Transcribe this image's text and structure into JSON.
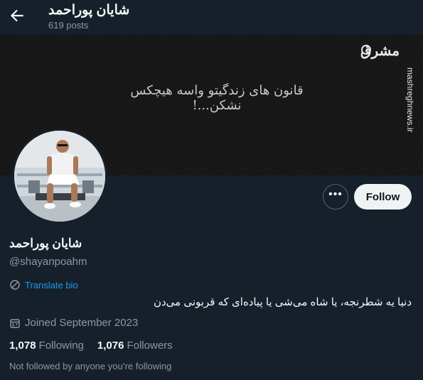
{
  "header": {
    "name": "شایان پوراحمد",
    "posts": "619 posts"
  },
  "banner": {
    "quote": "قانون های زندگیتو واسه هیچکس نشکن...!",
    "watermark_logo": "مشرق",
    "watermark_site": "mashreghnews.ir"
  },
  "actions": {
    "more": "•••",
    "follow": "Follow"
  },
  "profile": {
    "display_name": "شایان پوراحمد",
    "handle": "@shayanpoahm",
    "translate": "Translate bio",
    "bio": "دنیا یه شطرنجه، یا شاه می‌شی یا پیاده‌ای که قربونی می‌دن",
    "joined": "Joined September 2023",
    "following_count": "1,078",
    "following_label": "Following",
    "followers_count": "1,076",
    "followers_label": "Followers",
    "not_followed": "Not followed by anyone you’re following"
  },
  "colors": {
    "background": "#15202b",
    "link": "#1d9bf0",
    "secondary_text": "#8b98a5"
  }
}
